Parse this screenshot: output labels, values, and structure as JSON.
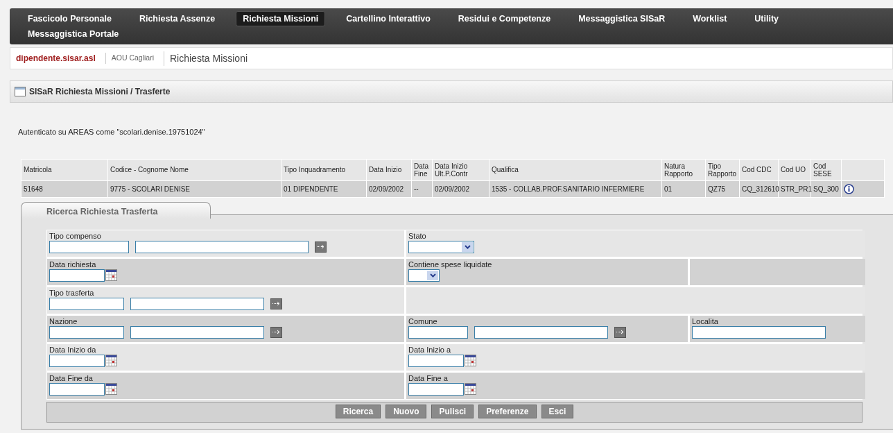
{
  "nav": [
    {
      "label": "Fascicolo Personale",
      "selected": false
    },
    {
      "label": "Richiesta Assenze",
      "selected": false
    },
    {
      "label": "Richiesta Missioni",
      "selected": true
    },
    {
      "label": "Cartellino Interattivo",
      "selected": false
    },
    {
      "label": "Residui e Competenze",
      "selected": false
    },
    {
      "label": "Messaggistica SISaR",
      "selected": false
    },
    {
      "label": "Worklist",
      "selected": false
    },
    {
      "label": "Utility",
      "selected": false
    },
    {
      "label": "Messaggistica Portale",
      "selected": false
    }
  ],
  "breadcrumb": [
    "dipendente.sisar.asl",
    "AOU Cagliari",
    "Richiesta Missioni"
  ],
  "panel": {
    "title": "SISaR Richiesta Missioni / Trasferte"
  },
  "auth_text": "Autenticato su AREAS come \"scolari.denise.19751024\"",
  "table": {
    "columns": [
      "Matricola",
      "Codice - Cognome Nome",
      "Tipo Inquadramento",
      "Data Inizio",
      "Data Fine",
      "Data Inizio Ult.P.Contr",
      "Qualifica",
      "Natura Rapporto",
      "Tipo Rapporto",
      "Cod CDC",
      "Cod UO",
      "Cod SESE"
    ],
    "rows": [
      [
        "51648",
        "9775  -  SCOLARI  DENISE",
        "01 DIPENDENTE",
        "02/09/2002",
        "--",
        "02/09/2002",
        "1535 - COLLAB.PROF.SANITARIO INFERMIERE",
        "01",
        "QZ75",
        "CQ_312610",
        "STR_PR1",
        "SQ_300"
      ]
    ]
  },
  "tabs": [
    {
      "label": "Ricerca Richiesta Trasferta",
      "selected": true
    }
  ],
  "form": [
    {
      "cells": [
        {
          "label": "Tipo compenso",
          "kind": "lookup"
        },
        {
          "label": "Stato",
          "kind": "select"
        }
      ]
    },
    {
      "cells": [
        {
          "label": "Data richiesta",
          "kind": "date"
        },
        {
          "label": "Contiene spese liquidate",
          "kind": "flag"
        },
        {
          "kind": "blank"
        }
      ]
    },
    {
      "cells": [
        {
          "label": "Tipo trasferta",
          "kind": "lookup"
        },
        {
          "kind": "blank"
        }
      ]
    },
    {
      "cells": [
        {
          "label": "Nazione",
          "kind": "lookup"
        },
        {
          "label": "Comune",
          "kind": "lookup"
        },
        {
          "label": "Localita",
          "kind": "text"
        }
      ]
    },
    {
      "cells": [
        {
          "label": "Data Inizio da",
          "kind": "date"
        },
        {
          "label": "Data Inizio a",
          "kind": "date"
        }
      ]
    },
    {
      "cells": [
        {
          "label": "Data Fine da",
          "kind": "date"
        },
        {
          "label": "Data Fine a",
          "kind": "date"
        }
      ]
    }
  ],
  "buttons": [
    "Ricerca",
    "Nuovo",
    "Pulisci",
    "Preferenze",
    "Esci"
  ]
}
